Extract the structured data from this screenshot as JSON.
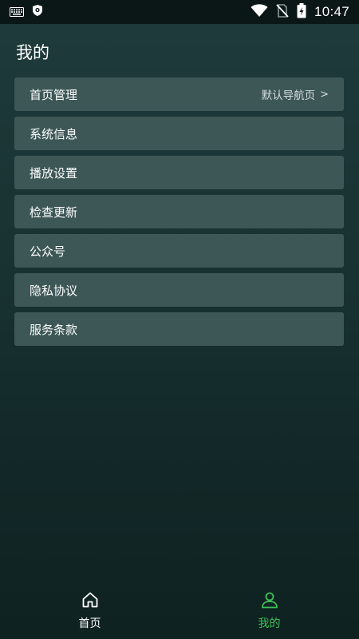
{
  "status_bar": {
    "time": "10:47",
    "icons": [
      "keyboard-icon",
      "shield-icon",
      "wifi-icon",
      "no-sim-icon",
      "battery-charging-icon"
    ]
  },
  "page": {
    "title": "我的"
  },
  "menu": {
    "items": [
      {
        "label": "首页管理",
        "value": "默认导航页",
        "arrow": ">"
      },
      {
        "label": "系统信息"
      },
      {
        "label": "播放设置"
      },
      {
        "label": "检查更新"
      },
      {
        "label": "公众号"
      },
      {
        "label": "隐私协议"
      },
      {
        "label": "服务条款"
      }
    ]
  },
  "tabs": [
    {
      "label": "首页",
      "icon": "home-icon",
      "active": false
    },
    {
      "label": "我的",
      "icon": "user-icon",
      "active": true
    }
  ],
  "colors": {
    "accent": "#3fbf57",
    "item_background": "#3d5757",
    "background_top": "#1f3b3b",
    "background_bottom": "#0f2222"
  }
}
